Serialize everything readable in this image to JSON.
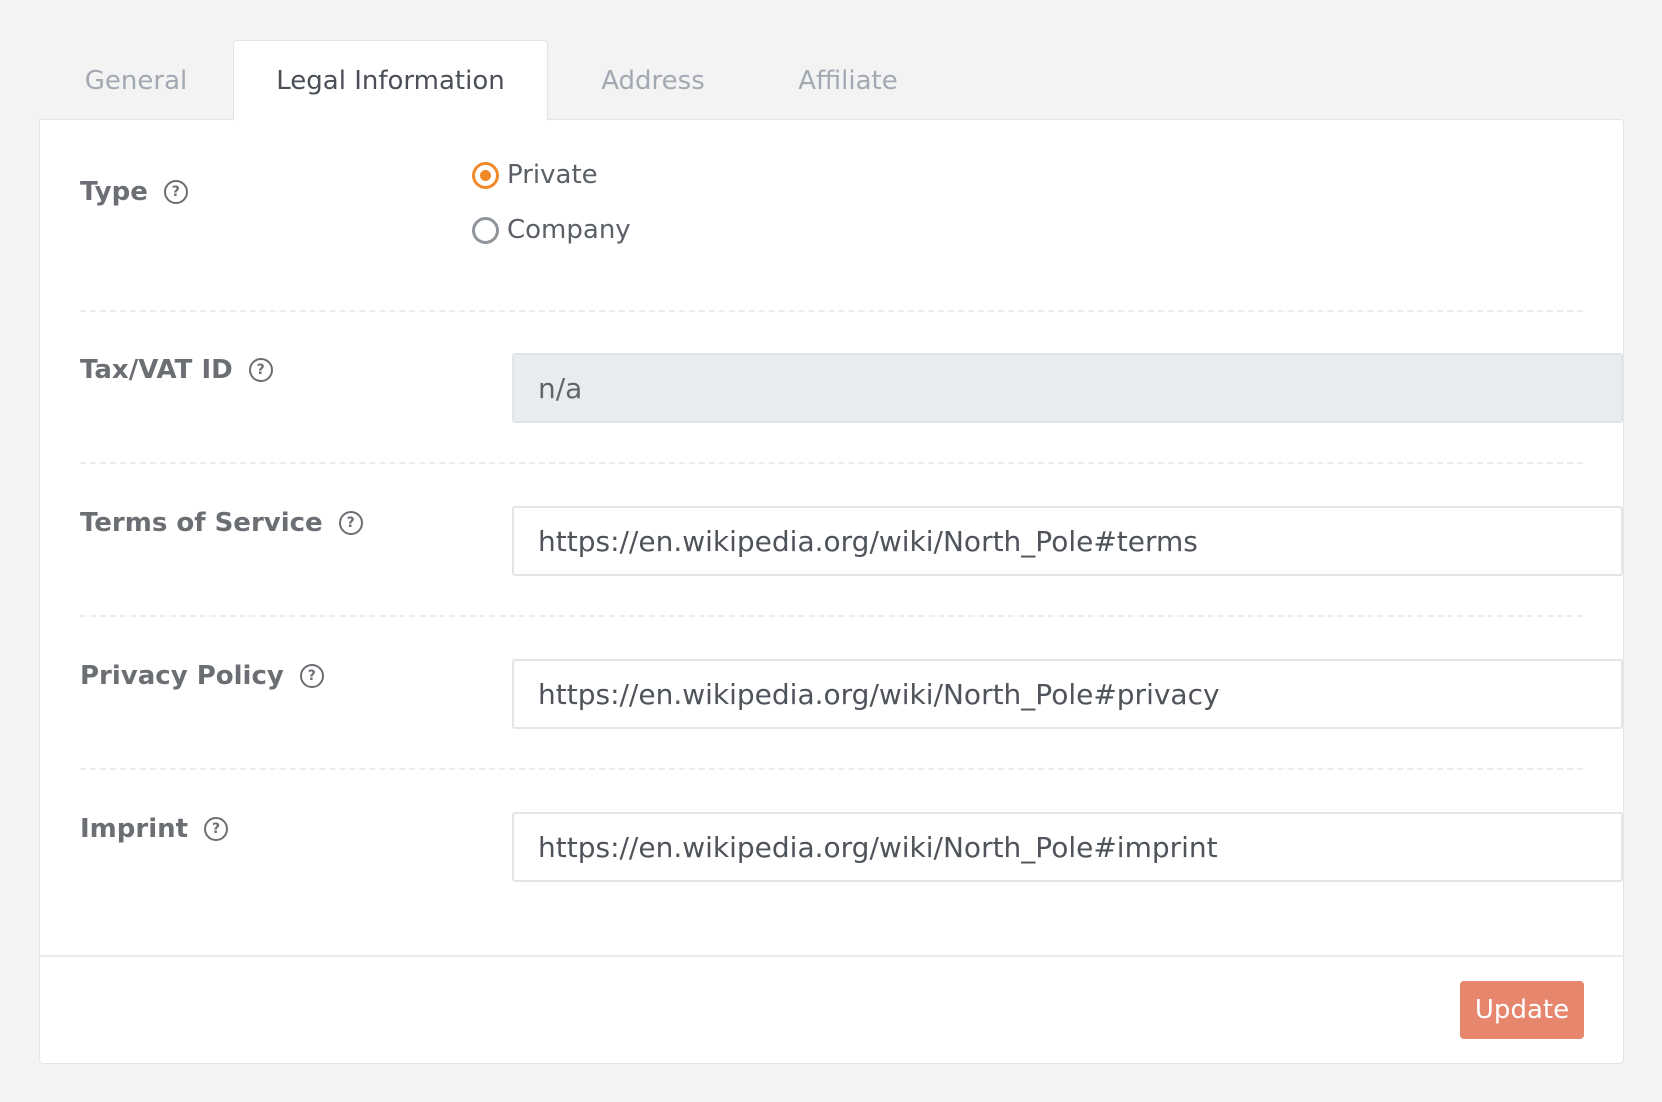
{
  "tabs": [
    {
      "label": "General",
      "active": false
    },
    {
      "label": "Legal Information",
      "active": true
    },
    {
      "label": "Address",
      "active": false
    },
    {
      "label": "Affiliate",
      "active": false
    }
  ],
  "form": {
    "type": {
      "label": "Type",
      "options": [
        {
          "label": "Private",
          "checked": true
        },
        {
          "label": "Company",
          "checked": false
        }
      ]
    },
    "tax_vat_id": {
      "label": "Tax/VAT ID",
      "value": "n/a"
    },
    "terms_of_service": {
      "label": "Terms of Service",
      "value": "https://en.wikipedia.org/wiki/North_Pole#terms"
    },
    "privacy_policy": {
      "label": "Privacy Policy",
      "value": "https://en.wikipedia.org/wiki/North_Pole#privacy"
    },
    "imprint": {
      "label": "Imprint",
      "value": "https://en.wikipedia.org/wiki/North_Pole#imprint"
    }
  },
  "help_glyph": "?",
  "footer": {
    "update_label": "Update"
  },
  "colors": {
    "accent": "#f08a2a",
    "update_button": "#e5866d"
  },
  "icons": {
    "help": "question-circle-icon",
    "radio_checked": "radio-checked-icon",
    "radio_unchecked": "radio-unchecked-icon"
  }
}
